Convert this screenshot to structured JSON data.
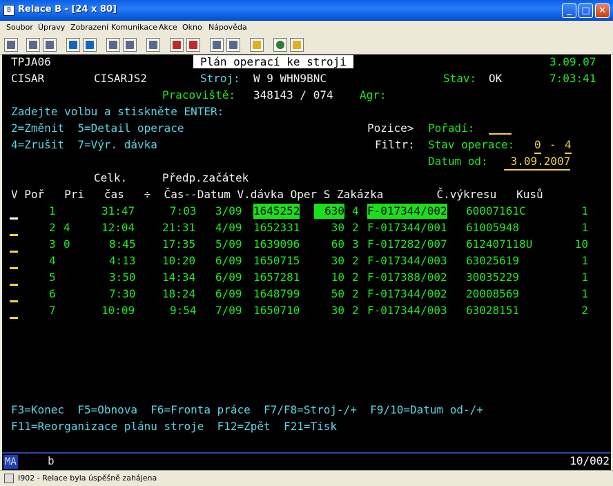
{
  "window": {
    "title": "Relace B - [24 x 80]",
    "minimize": "_",
    "maximize": "□",
    "close": "✕"
  },
  "menu": [
    "Soubor",
    "Úpravy",
    "Zobrazení",
    "Komunikace",
    "Akce",
    "Okno",
    "Nápověda"
  ],
  "toolbar": [
    "print",
    "copy",
    "paste",
    "send",
    "receive",
    "display",
    "display-2",
    "record",
    "play",
    "macro",
    "macro-2",
    "clipboard",
    "globe",
    "edit"
  ],
  "screen": {
    "program": "TPJA06",
    "title": "Plán operací ke stroji",
    "date": "3.09.07",
    "user": "CISAR",
    "session": "CISARJS2",
    "stroj_label": "Stroj:",
    "stroj_value": "W 9 WHN9BNC",
    "stav_label": "Stav:",
    "stav_value": "OK",
    "time": "7:03:41",
    "pracoviste_label": "Pracoviště:",
    "pracoviste_value": "348143 / 074",
    "agr_label": "Agr:",
    "instruction": "Zadejte volbu a stiskněte ENTER:",
    "opt_line1": "2=Změnit  5=Detail operace",
    "opt_line2": "4=Zrušit  7=Výr. dávka",
    "pozice_label": "Pozice>",
    "poradi_label": "Pořadí:",
    "poradi_value": "",
    "filtr_label": "Filtr:",
    "stav_op_label": "Stav operace:",
    "stav_op_from": "0",
    "stav_op_dash": "-",
    "stav_op_to": "4",
    "datum_od_label": "Datum od:",
    "datum_od_value": " 3.09.2007",
    "header_row1_celk": "Celk.",
    "header_row1_predp": "Předp.začátek",
    "header_row2": "V Poř   Pri   čas   ÷  Čas--Datum V.dávka Oper S Zakázka        Č.výkresu   Kusů",
    "rows": [
      {
        "por": "1",
        "pri": "",
        "cas": "31:47",
        "zac": "7:03",
        "datum": "3/09",
        "davka": "1645252",
        "oper": "630",
        "s": "4",
        "zakazka": "F-017344/002",
        "vykres": "60007161C",
        "kusu": "1"
      },
      {
        "por": "2",
        "pri": "4",
        "cas": "12:04",
        "zac": "21:31",
        "datum": "4/09",
        "davka": "1652331",
        "oper": "30",
        "s": "2",
        "zakazka": "F-017344/001",
        "vykres": "61005948",
        "kusu": "1"
      },
      {
        "por": "3",
        "pri": "0",
        "cas": "8:45",
        "zac": "17:35",
        "datum": "5/09",
        "davka": "1639096",
        "oper": "60",
        "s": "3",
        "zakazka": "F-017282/007",
        "vykres": "612407118U",
        "kusu": "10"
      },
      {
        "por": "4",
        "pri": "",
        "cas": "4:13",
        "zac": "10:20",
        "datum": "6/09",
        "davka": "1650715",
        "oper": "30",
        "s": "2",
        "zakazka": "F-017344/003",
        "vykres": "63025619",
        "kusu": "1"
      },
      {
        "por": "5",
        "pri": "",
        "cas": "3:50",
        "zac": "14:34",
        "datum": "6/09",
        "davka": "1657281",
        "oper": "10",
        "s": "2",
        "zakazka": "F-017388/002",
        "vykres": "30035229",
        "kusu": "1"
      },
      {
        "por": "6",
        "pri": "",
        "cas": "7:30",
        "zac": "18:24",
        "datum": "6/09",
        "davka": "1648799",
        "oper": "50",
        "s": "2",
        "zakazka": "F-017344/002",
        "vykres": "20008569",
        "kusu": "1"
      },
      {
        "por": "7",
        "pri": "",
        "cas": "10:09",
        "zac": "9:54",
        "datum": "7/09",
        "davka": "1650710",
        "oper": "30",
        "s": "2",
        "zakazka": "F-017344/003",
        "vykres": "63028151",
        "kusu": "2"
      }
    ],
    "fkeys_line1": "F3=Konec  F5=Obnova  F6=Fronta práce  F7/F8=Stroj-/+  F9/10=Datum od-/+",
    "fkeys_line2": "F11=Reorganizace plánu stroje  F12=Zpět  F21=Tisk"
  },
  "oia": {
    "mode": "MA",
    "indicator": "b",
    "position": "10/002"
  },
  "statusbar": {
    "message": "I902 - Relace byla úspěšně zahájena"
  },
  "colors": {
    "green": "#22e822",
    "cyan": "#5ad6e6",
    "yellow": "#f6d146",
    "white": "#f2f2f2",
    "highlight": "#19e019"
  }
}
